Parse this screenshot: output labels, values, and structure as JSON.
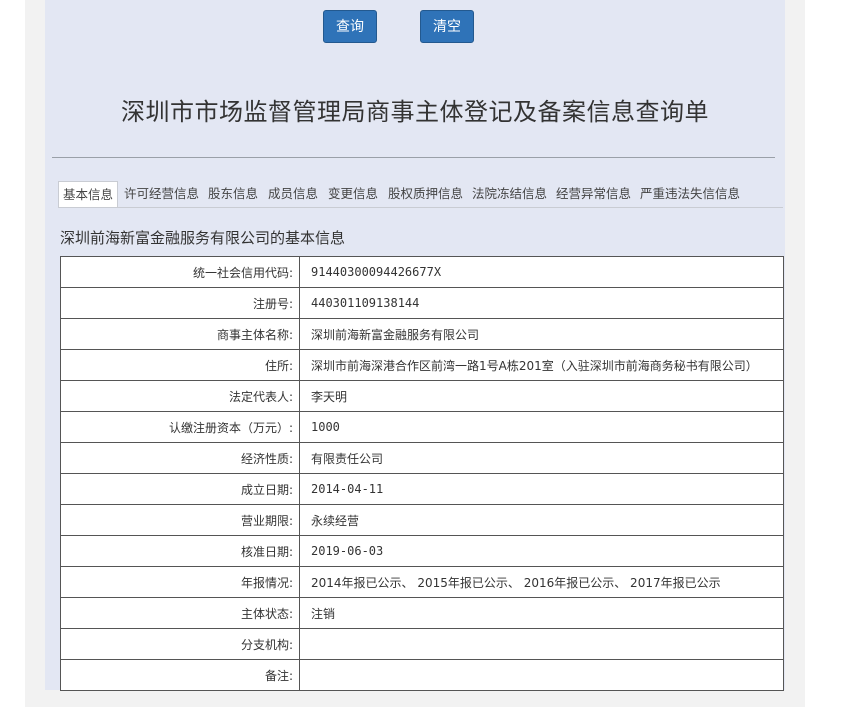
{
  "toolbar": {
    "query_label": "查询",
    "clear_label": "清空"
  },
  "title": "深圳市市场监督管理局商事主体登记及备案信息查询单",
  "tabs": [
    "基本信息",
    "许可经营信息",
    "股东信息",
    "成员信息",
    "变更信息",
    "股权质押信息",
    "法院冻结信息",
    "经营异常信息",
    "严重违法失信信息"
  ],
  "section_title": "深圳前海新富金融服务有限公司的基本信息",
  "rows": [
    {
      "label": "统一社会信用代码:",
      "value": "91440300094426677X"
    },
    {
      "label": "注册号:",
      "value": "440301109138144"
    },
    {
      "label": "商事主体名称:",
      "value": "深圳前海新富金融服务有限公司"
    },
    {
      "label": "住所:",
      "value": "深圳市前海深港合作区前湾一路1号A栋201室（入驻深圳市前海商务秘书有限公司）"
    },
    {
      "label": "法定代表人:",
      "value": "李天明"
    },
    {
      "label": "认缴注册资本（万元）:",
      "value": "1000"
    },
    {
      "label": "经济性质:",
      "value": "有限责任公司"
    },
    {
      "label": "成立日期:",
      "value": "2014-04-11"
    },
    {
      "label": "营业期限:",
      "value": "永续经营"
    },
    {
      "label": "核准日期:",
      "value": "2019-06-03"
    },
    {
      "label": "年报情况:",
      "value": "2014年报已公示、 2015年报已公示、 2016年报已公示、 2017年报已公示"
    },
    {
      "label": "主体状态:",
      "value": "注销"
    },
    {
      "label": "分支机构:",
      "value": ""
    },
    {
      "label": "备注:",
      "value": ""
    }
  ]
}
